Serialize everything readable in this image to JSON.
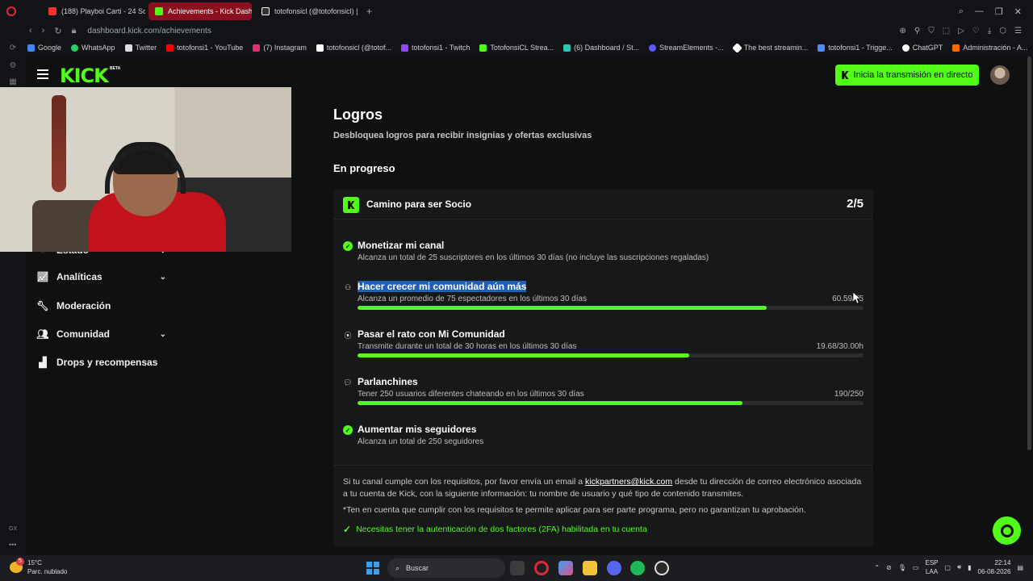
{
  "browser": {
    "tabs": [
      {
        "label": "(188) Playboi Carti - 24 Son",
        "color": "#ff2d2d"
      },
      {
        "label": "Achievements - Kick Dashb",
        "color": "#53fc18"
      },
      {
        "label": "totofonsicl (@totofonsicl) |",
        "color": "#ffffff"
      }
    ],
    "url_domain": "dashboard.kick.com",
    "url_path": "/achievements",
    "bookmarks": [
      {
        "label": "Google",
        "color": "#4285f4"
      },
      {
        "label": "WhatsApp",
        "color": "#25d366"
      },
      {
        "label": "Twitter",
        "color": "#dddddd"
      },
      {
        "label": "totofonsi1 - YouTube",
        "color": "#ff0000"
      },
      {
        "label": "(7) Instagram",
        "color": "#e1306c"
      },
      {
        "label": "totofonsicl (@totof...",
        "color": "#ffffff"
      },
      {
        "label": "totofonsi1 - Twitch",
        "color": "#9146ff"
      },
      {
        "label": "TotofonsiCL Strea...",
        "color": "#53fc18"
      },
      {
        "label": "(6) Dashboard / St...",
        "color": "#2ec4b6"
      },
      {
        "label": "StreamElements -...",
        "color": "#5b5bff"
      },
      {
        "label": "The best streamin...",
        "color": "#ffffff"
      },
      {
        "label": "totofonsi1 - Trigge...",
        "color": "#4c8bf5"
      },
      {
        "label": "ChatGPT",
        "color": "#ffffff"
      },
      {
        "label": "Administración - A...",
        "color": "#ff6a00"
      }
    ]
  },
  "header": {
    "logo": "KICK",
    "beta": "BETA",
    "go_live_label": "Inicia la transmisión en directo"
  },
  "sidebar": {
    "items": [
      {
        "label": "Estado"
      },
      {
        "label": "Analíticas"
      },
      {
        "label": "Moderación"
      },
      {
        "label": "Comunidad"
      },
      {
        "label": "Drops y recompensas"
      }
    ]
  },
  "main": {
    "title": "Logros",
    "subtitle": "Desbloquea logros para recibir insignias y ofertas exclusivas",
    "section": "En progreso",
    "card": {
      "title": "Camino para ser Socio",
      "progress": "2/5",
      "achievements": [
        {
          "title": "Monetizar mi canal",
          "desc": "Alcanza un total de 25 suscriptores en los últimos 30 días (no incluye las suscripciones regaladas)",
          "value": "",
          "done": true,
          "progress": 1.0,
          "icon": "check-icon"
        },
        {
          "title": "Hacer crecer mi comunidad aún más",
          "desc": "Alcanza un promedio de 75 espectadores en los últimos 30 días",
          "value": "60.59/75",
          "done": false,
          "progress": 0.808,
          "icon": "users-icon"
        },
        {
          "title": "Pasar el rato con Mi Comunidad",
          "desc": "Transmite durante un total de 30 horas en los últimos 30 días",
          "value": "19.68/30.00h",
          "done": false,
          "progress": 0.656,
          "icon": "broadcast-icon"
        },
        {
          "title": "Parlanchines",
          "desc": "Tener 250 usuarios diferentes chateando en los últimos 30 días",
          "value": "190/250",
          "done": false,
          "progress": 0.76,
          "icon": "chat-icon"
        },
        {
          "title": "Aumentar mis seguidores",
          "desc": "Alcanza un total de 250 seguidores",
          "value": "",
          "done": true,
          "progress": 1.0,
          "icon": "check-icon"
        }
      ],
      "note1_pre": "Si tu canal cumple con los requisitos, por favor envía un email a ",
      "note1_link": "kickpartners@kick.com",
      "note1_post": " desde tu dirección de correo electrónico asociada a tu cuenta de Kick, con la siguiente información: tu nombre de usuario y qué tipo de contenido transmites.",
      "note2": "*Ten en cuenta que cumplir con los requisitos te permite aplicar para ser parte programa, pero no garantizan tu aprobación.",
      "note3": "Necesitas tener la autenticación de dos factores (2FA) habilitada en tu cuenta"
    }
  },
  "taskbar": {
    "weather_temp": "15°C",
    "weather_desc": "Parc. nublado",
    "weather_badge": "5",
    "search_label": "Buscar",
    "lang_top": "ESP",
    "lang_bottom": "LAA",
    "time": "22:14",
    "date": "06-08-2026"
  },
  "rail": {
    "gx": "GX"
  }
}
